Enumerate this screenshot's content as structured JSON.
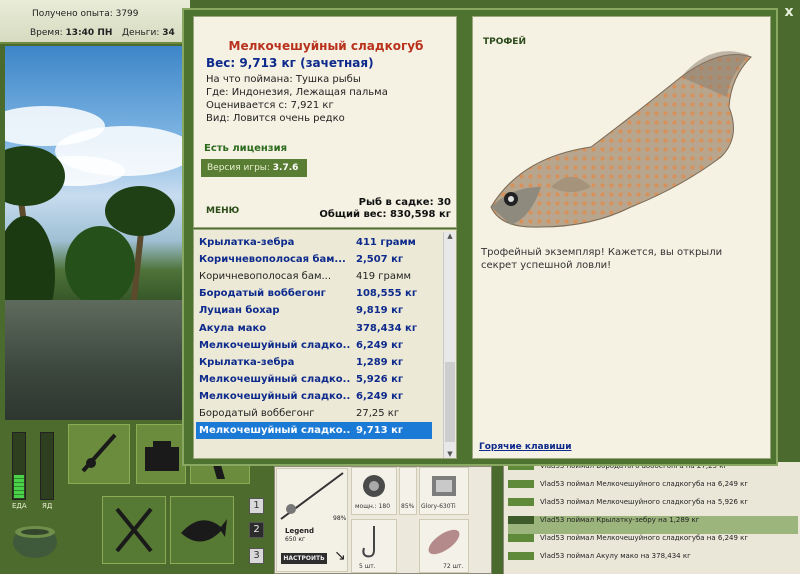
{
  "hud": {
    "experience": "Получено опыта: 3799",
    "time_label": "Время:",
    "time_value": "13:40 ПН",
    "money_label": "Деньги:",
    "money_value": "34"
  },
  "meters": {
    "food_label": "ЕДА",
    "drink_label": "ЯД",
    "food_level": 0.35,
    "drink_level": 0.0
  },
  "dialog": {
    "close": "x",
    "fish_name": "Мелкочешуйный сладкогуб",
    "weight": "Вес: 9,713 кг (зачетная)",
    "caught_on": "На что поймана: Тушка рыбы",
    "where": "Где: Индонезия, Лежащая пальма",
    "valued_from": "Оценивается с: 7,921 кг",
    "kind": "Вид: Ловится очень редко",
    "license": "Есть лицензия",
    "version_label": "Версия игры: ",
    "version_value": "3.7.6",
    "menu": "МЕНЮ",
    "fish_in_cage": "Рыб в садке: 30",
    "total_weight": "Общий вес: 830,598 кг"
  },
  "catches": [
    {
      "name": "Крылатка-зебра",
      "weight": "411 грамм",
      "style": "rec"
    },
    {
      "name": "Коричневополосая бам...",
      "weight": "2,507 кг",
      "style": "rec"
    },
    {
      "name": "Коричневополосая бам...",
      "weight": "419 грамм",
      "style": "norm"
    },
    {
      "name": "Бородатый воббегонг",
      "weight": "108,555 кг",
      "style": "rec"
    },
    {
      "name": "Луциан бохар",
      "weight": "9,819 кг",
      "style": "rec"
    },
    {
      "name": "Акула мако",
      "weight": "378,434 кг",
      "style": "rec"
    },
    {
      "name": "Мелкочешуйный сладко...",
      "weight": "6,249 кг",
      "style": "rec"
    },
    {
      "name": "Крылатка-зебра",
      "weight": "1,289 кг",
      "style": "rec"
    },
    {
      "name": "Мелкочешуйный сладко...",
      "weight": "5,926 кг",
      "style": "rec"
    },
    {
      "name": "Мелкочешуйный сладко...",
      "weight": "6,249 кг",
      "style": "rec"
    },
    {
      "name": "Бородатый воббегонг",
      "weight": "27,25 кг",
      "style": "norm"
    },
    {
      "name": "Мелкочешуйный сладко...",
      "weight": "9,713 кг",
      "style": "sel"
    }
  ],
  "trophy": {
    "title": "ТРОФЕЙ",
    "text": "Трофейный экземпляр! Кажется, вы открыли секрет успешной ловли!",
    "hotkeys": "Горячие клавиши"
  },
  "bottom": {
    "pages": [
      "1",
      "2",
      "3"
    ],
    "rod_percent": "98%",
    "rod_name": "Legend",
    "rod_weight": "650 кг",
    "setup_button": "НАСТРОИТЬ",
    "tackle_caption_1": "мощн.: 180",
    "tackle_caption_2": "85%",
    "tackle_caption_3": "Glory-630Ti",
    "hook_count": "5 шт.",
    "bait_count": "72 шт."
  },
  "chat": [
    "Vlad53 поймал Бородатого воббегонга на 27,25 кг",
    "Vlad53 поймал Мелкочешуйного сладкогуба на 6,249 кг",
    "Vlad53 поймал Мелкочешуйного сладкогуба на 5,926 кг",
    "Vlad53 поймал Крылатку-зебру на 1,289 кг",
    "Vlad53 поймал Мелкочешуйного сладкогуба на 6,249 кг",
    "Vlad53 поймал Акулу мако на 378,434 кг"
  ]
}
